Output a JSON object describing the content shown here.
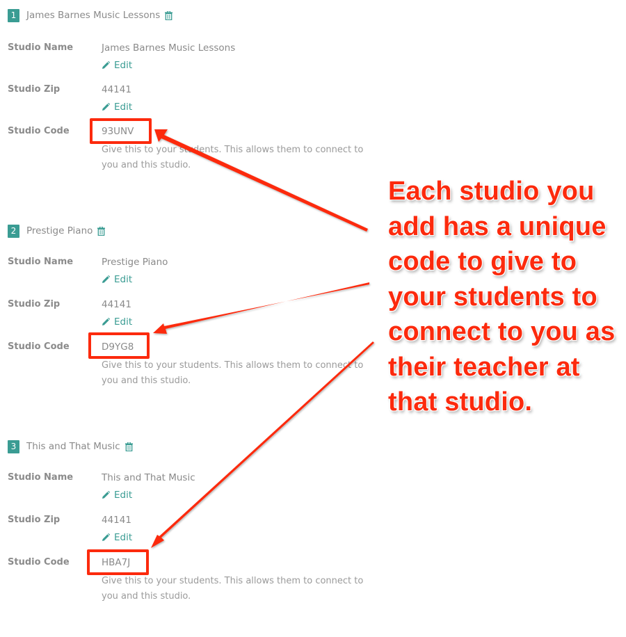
{
  "colors": {
    "accent": "#3a9c93",
    "annotation": "#fc2a0d",
    "text": "#8a8a8a"
  },
  "labels": {
    "studio_name": "Studio Name",
    "studio_zip": "Studio Zip",
    "studio_code": "Studio Code",
    "edit": "Edit",
    "code_help": "Give this to your students. This allows them to connect to you and this studio."
  },
  "studios": [
    {
      "number": "1",
      "title": "James Barnes Music Lessons",
      "name": "James Barnes Music Lessons",
      "zip": "44141",
      "code": "93UNV"
    },
    {
      "number": "2",
      "title": "Prestige Piano",
      "name": "Prestige Piano",
      "zip": "44141",
      "code": "D9YG8"
    },
    {
      "number": "3",
      "title": "This and That Music",
      "name": "This and That Music",
      "zip": "44141",
      "code": "HBA7J"
    }
  ],
  "annotation": {
    "text": "Each studio you add has a unique code to give to your students to connect to you as their teacher at that studio."
  },
  "icons": {
    "delete": "trash-icon",
    "edit": "pencil-icon"
  }
}
